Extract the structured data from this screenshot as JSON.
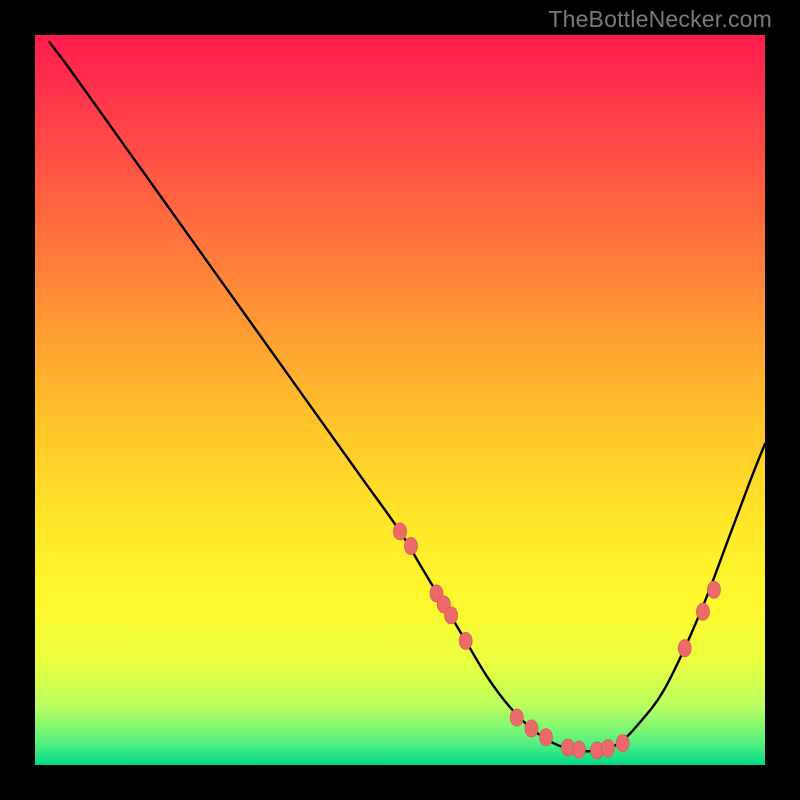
{
  "watermark": "TheBottleNecker.com",
  "colors": {
    "curve": "#000000",
    "marker": "#ec6a6a",
    "markerStroke": "#d95a5a"
  },
  "chart_data": {
    "type": "line",
    "title": "",
    "xlabel": "",
    "ylabel": "",
    "xlim": [
      0,
      100
    ],
    "ylim": [
      0,
      100
    ],
    "series": [
      {
        "name": "bottleneck-curve",
        "x": [
          2,
          5,
          10,
          15,
          20,
          25,
          30,
          35,
          40,
          45,
          50,
          53,
          56,
          59,
          62,
          65,
          68,
          71,
          74,
          77,
          80,
          83,
          86,
          89,
          92,
          95,
          98,
          100
        ],
        "y": [
          99,
          95,
          88,
          81,
          74,
          67,
          60,
          53,
          46,
          39,
          32,
          27,
          22,
          17,
          12,
          8,
          5,
          3,
          2,
          2,
          3,
          6,
          10,
          16,
          23,
          31,
          39,
          44
        ]
      }
    ],
    "markers": {
      "name": "highlight-points",
      "x": [
        50,
        51.5,
        55,
        56,
        57,
        59,
        66,
        68,
        70,
        73,
        74.5,
        77,
        78.5,
        80.5,
        89,
        91.5,
        93
      ],
      "y": [
        32,
        30,
        23.5,
        22,
        20.5,
        17,
        6.5,
        5,
        3.8,
        2.4,
        2.1,
        2,
        2.3,
        3,
        16,
        21,
        24
      ]
    }
  }
}
